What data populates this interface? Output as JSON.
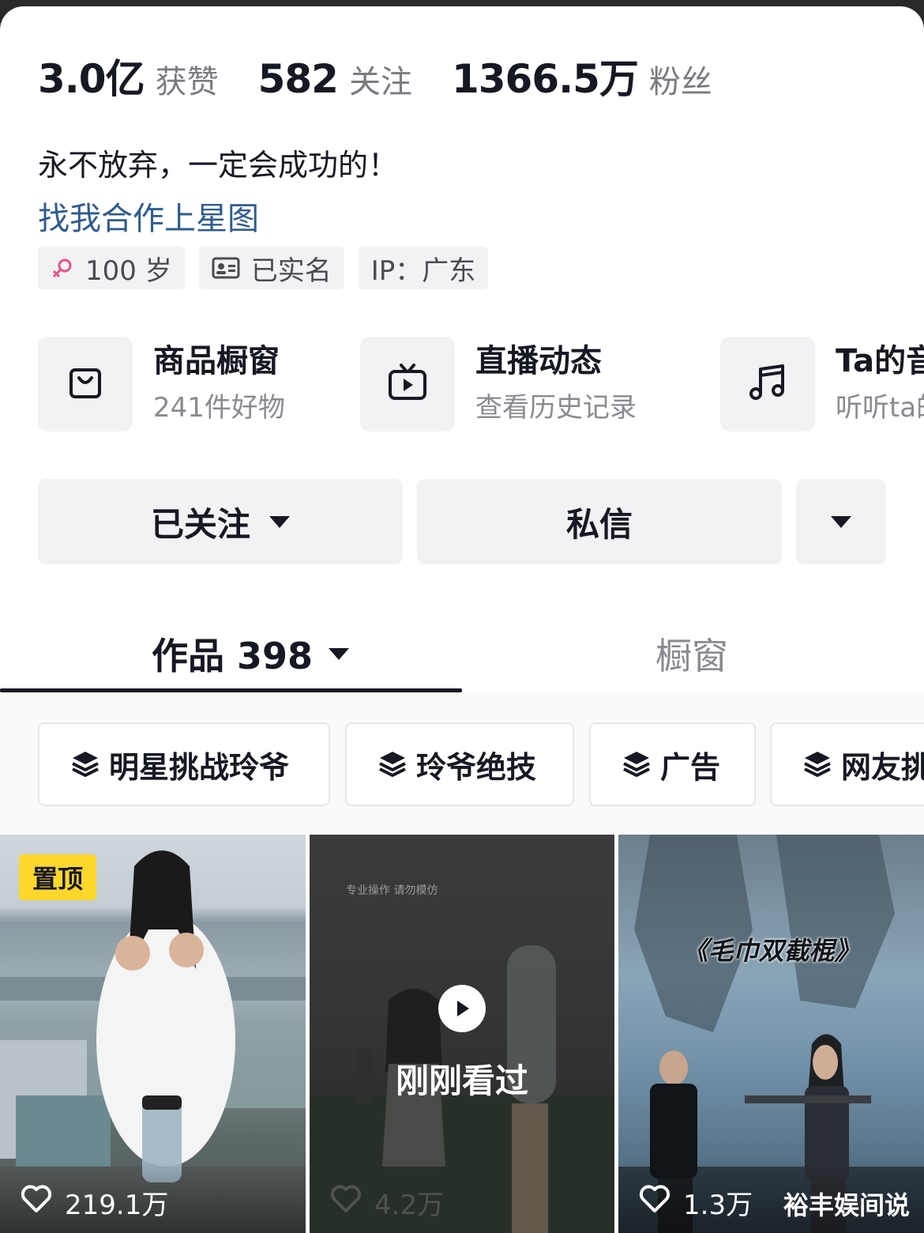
{
  "stats": [
    {
      "value": "3.0亿",
      "label": "获赞"
    },
    {
      "value": "582",
      "label": "关注"
    },
    {
      "value": "1366.5万",
      "label": "粉丝"
    }
  ],
  "bio": {
    "text": "永不放弃，一定会成功的！",
    "link": "找我合作上星图"
  },
  "tags": {
    "age": "100 岁",
    "verified": "已实名",
    "ip": "IP：广东"
  },
  "cards": [
    {
      "icon": "shopping-bag-icon",
      "title": "商品橱窗",
      "subtitle": "241件好物"
    },
    {
      "icon": "tv-play-icon",
      "title": "直播动态",
      "subtitle": "查看历史记录"
    },
    {
      "icon": "music-note-icon",
      "title": "Ta的音",
      "subtitle": "听听ta的"
    }
  ],
  "actions": {
    "follow": "已关注",
    "message": "私信"
  },
  "tabs": {
    "works": "作品 398",
    "showcase": "橱窗"
  },
  "collections": [
    "明星挑战玲爷",
    "玲爷绝技",
    "广告",
    "网友挑"
  ],
  "videos": [
    {
      "badge": "置顶",
      "likes": "219.1万"
    },
    {
      "overlay": "刚刚看过",
      "caption": "专业操作 请勿模仿",
      "likes": "4.2万"
    },
    {
      "title": "《毛巾双截棍》",
      "likes": "1.3万",
      "watermark": "裕丰娱间说"
    }
  ],
  "colors": {
    "link": "#2e5c8f",
    "badge": "#fdd72a",
    "gender_icon": "#e8508a"
  }
}
